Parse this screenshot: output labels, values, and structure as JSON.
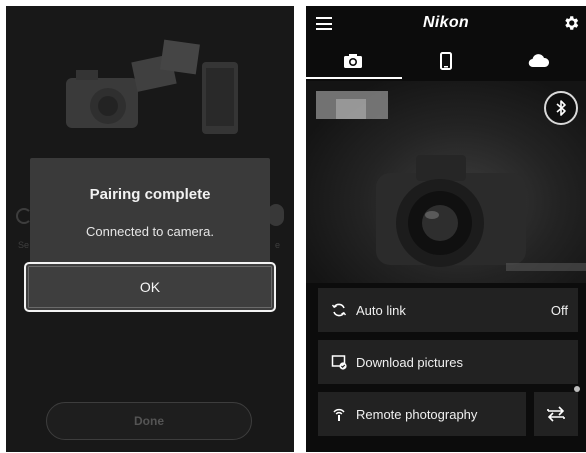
{
  "left_screen": {
    "dialog": {
      "title": "Pairing complete",
      "message": "Connected to camera.",
      "ok_label": "OK"
    },
    "done_label": "Done"
  },
  "right_screen": {
    "app_title": "Nikon",
    "tabs": [
      {
        "icon": "camera-icon",
        "active": true
      },
      {
        "icon": "phone-icon",
        "active": false
      },
      {
        "icon": "cloud-icon",
        "active": false
      }
    ],
    "bluetooth_icon": "bluetooth-icon",
    "menu": {
      "auto_link": {
        "label": "Auto link",
        "value": "Off"
      },
      "download": {
        "label": "Download pictures"
      },
      "remote": {
        "label": "Remote photography"
      }
    }
  },
  "colors": {
    "left_background": "#181818",
    "dialog_background": "#3a3a3a",
    "right_background": "#0c0c0c",
    "row_background": "#222222"
  }
}
